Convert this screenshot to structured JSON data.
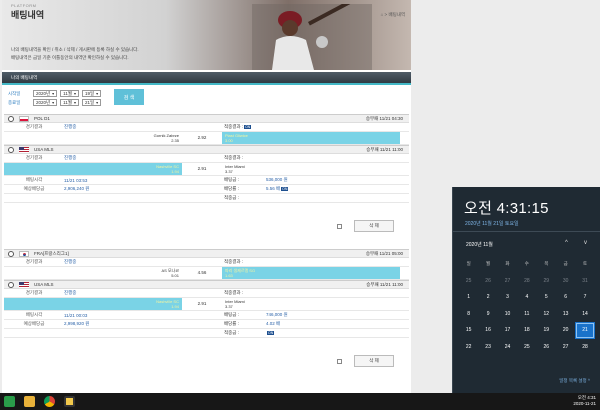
{
  "header": {
    "brand": "PLATFORM",
    "title": "배팅내역",
    "breadcrumb": "⌂ > 배팅내역",
    "intro_line1": "나의 배팅내역을 확인 / 취소 / 삭제 / 게시판에 등록 하실 수 있습니다.",
    "intro_line2": "배팅내역은 금일 기준 이틀동안의 내역만 확인하실 수 있습니다."
  },
  "section": {
    "title": "나의 배팅내역"
  },
  "filters": {
    "start_label": "시작일",
    "end_label": "종료일",
    "start": {
      "year": "2020년",
      "month": "11월",
      "day": "19일"
    },
    "end": {
      "year": "2020년",
      "month": "11월",
      "day": "21일"
    },
    "search_label": "검 색"
  },
  "labels": {
    "game_result": "경기결과",
    "bet_result": "적중결과 :",
    "bet_time": "배팅시각",
    "expected_payout": "예상배당금",
    "bet_amount": "배팅금 :",
    "bet_odds": "배당률 :",
    "win_amount": "적중금 :",
    "on": "ON",
    "delete": "삭 제",
    "in_progress": "진행중"
  },
  "bets": [
    {
      "games": [
        {
          "league": "POL D1",
          "time": "승무패 11/21 04:30",
          "home": "Gornik Zabrze",
          "home_odds": "2.35",
          "draw_odds": "2.92",
          "away": "Piast Gliwice",
          "away_odds": "3.00",
          "selected": "away"
        },
        {
          "league": "USA MLS",
          "time": "승무패 11/21 11:00",
          "home": "Nashville SC",
          "home_odds": "1.94",
          "draw_odds": "2.91",
          "away": "Inter Miami",
          "away_odds": "3.37",
          "selected": "home"
        }
      ],
      "bet_time": "11/21 03:53",
      "expected_payout": "2,906,240 원",
      "bet_amount": "536,000 원",
      "bet_odds": "5.56 배",
      "win_amount": ""
    },
    {
      "games": [
        {
          "league": "FRA[프랑스리그1]",
          "time": "승무패 11/21 05:00",
          "home": "AS 모나코",
          "home_odds": "5.01",
          "draw_odds": "4.56",
          "away": "파리 생제르맹 SG",
          "away_odds": "1.63",
          "selected": "away"
        },
        {
          "league": "USA MLS",
          "time": "승무패 11/21 11:00",
          "home": "Nashville SC",
          "home_odds": "1.94",
          "draw_odds": "2.91",
          "away": "Inter Miami",
          "away_odds": "3.37",
          "selected": "home"
        }
      ],
      "bet_time": "11/21 00:03",
      "expected_payout": "2,998,920 원",
      "bet_amount": "746,000 원",
      "bet_odds": "4.02 배",
      "win_amount": ""
    }
  ],
  "flyout": {
    "time": "오전 4:31:15",
    "date": "2020년 11월 21일 토요일",
    "month": "2020년 11월",
    "nav_up": "^",
    "nav_down": "v",
    "weekdays": [
      "일",
      "월",
      "화",
      "수",
      "목",
      "금",
      "토"
    ],
    "weeks": [
      [
        "1",
        "2",
        "3",
        "4",
        "5",
        "6",
        "7"
      ],
      [
        "8",
        "9",
        "10",
        "11",
        "12",
        "13",
        "14"
      ],
      [
        "15",
        "16",
        "17",
        "18",
        "19",
        "20",
        "21"
      ],
      [
        "22",
        "23",
        "24",
        "25",
        "26",
        "27",
        "28"
      ]
    ],
    "leading_days": [
      "25",
      "26",
      "27",
      "28",
      "29",
      "30",
      "31"
    ],
    "today": "21",
    "settings_link": "일정 목록 설정 ^"
  },
  "taskbar": {
    "clock_time": "오전 4:31",
    "clock_date": "2020-11-21"
  }
}
